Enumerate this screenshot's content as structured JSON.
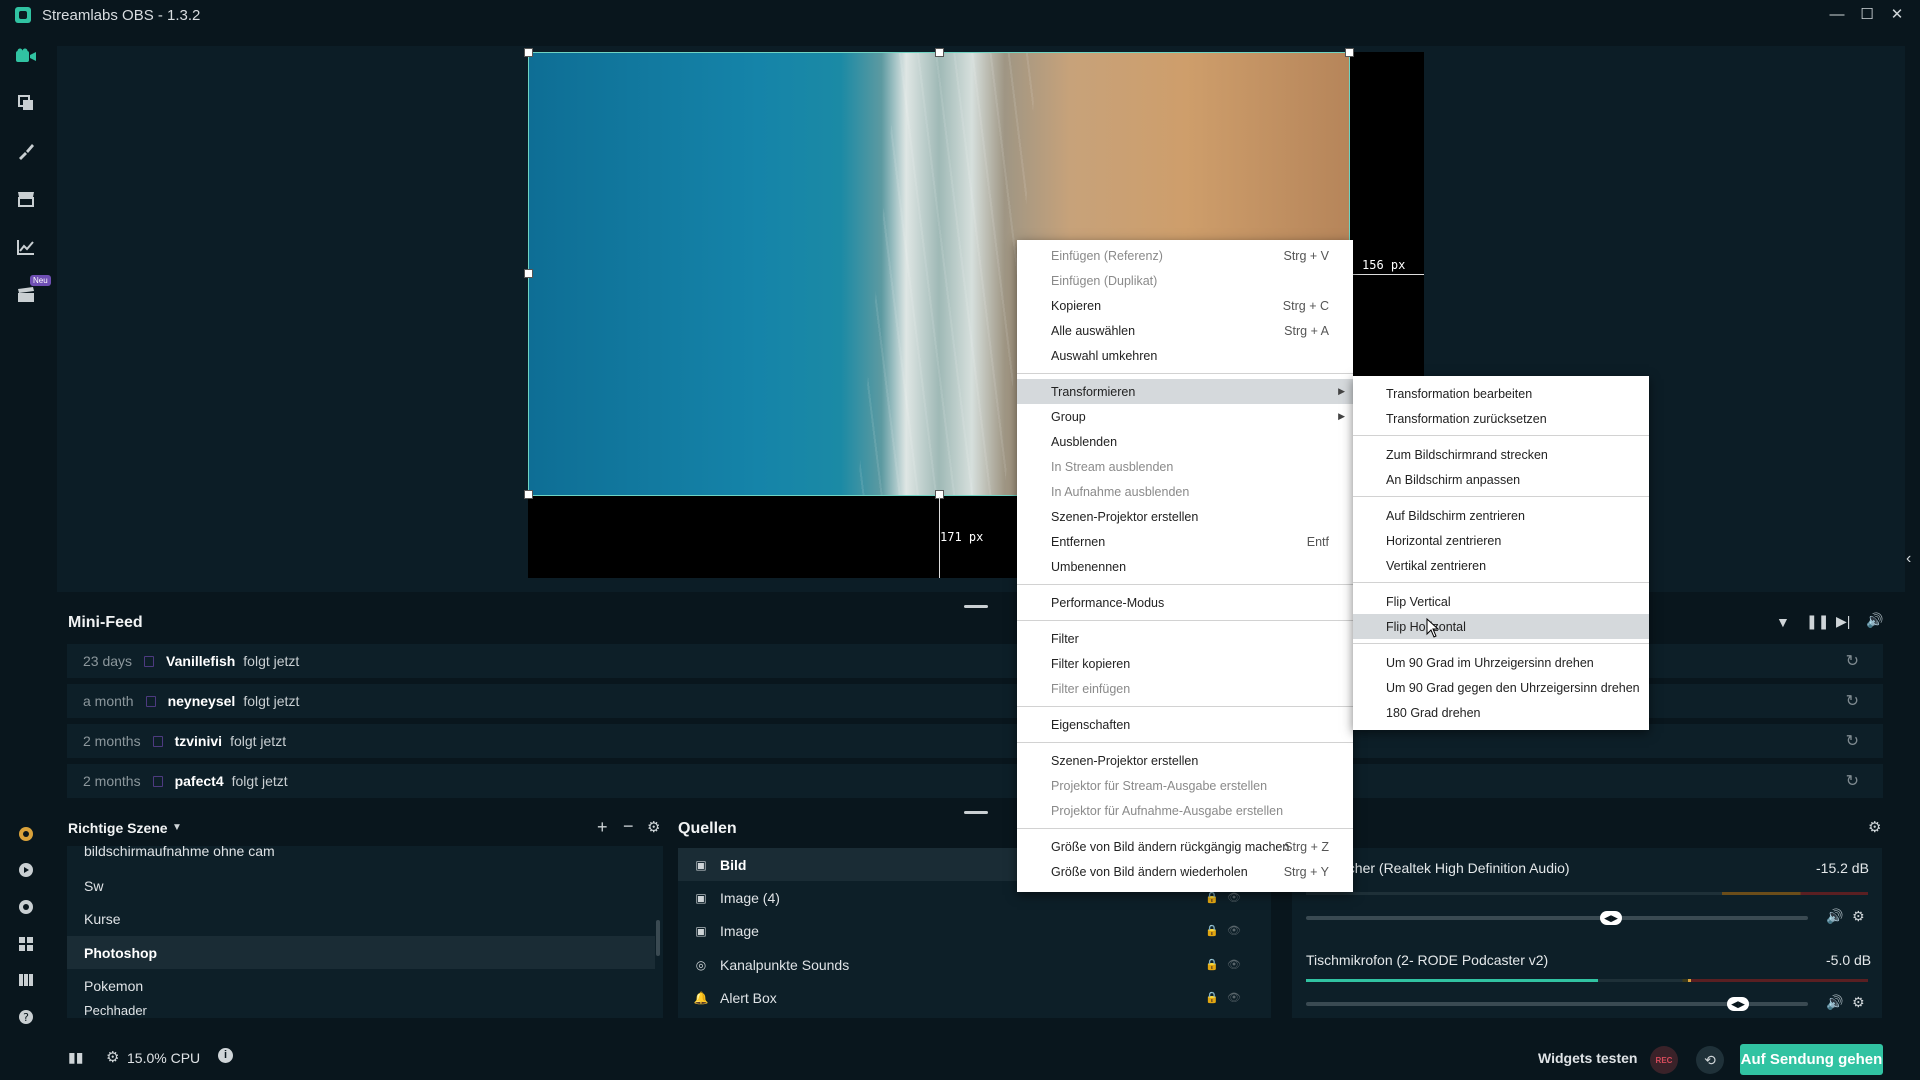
{
  "window": {
    "title": "Streamlabs OBS - 1.3.2",
    "min": "—",
    "max": "☐",
    "close": "✕"
  },
  "sidebar": {
    "neu_badge": "Neu"
  },
  "preview": {
    "px_right": "156 px",
    "px_bottom": "171 px"
  },
  "minifeed": {
    "title": "Mini-Feed",
    "rows": [
      {
        "time": "23 days",
        "user": "Vanillefish",
        "action": "folgt jetzt"
      },
      {
        "time": "a month",
        "user": "neyneysel",
        "action": "folgt jetzt"
      },
      {
        "time": "2 months",
        "user": "tzvinivi",
        "action": "folgt jetzt"
      },
      {
        "time": "2 months",
        "user": "pafect4",
        "action": "folgt jetzt"
      }
    ]
  },
  "scenes": {
    "title": "Richtige Szene",
    "items": [
      "bildschirmaufnahme ohne cam",
      "Sw",
      "Kurse",
      "Photoshop",
      "Pokemon",
      "Pechhader"
    ]
  },
  "sources": {
    "title": "Quellen",
    "items": [
      {
        "label": "Bild",
        "icon": "image-icon"
      },
      {
        "label": "Image (4)",
        "icon": "image-icon"
      },
      {
        "label": "Image",
        "icon": "image-icon"
      },
      {
        "label": "Kanalpunkte Sounds",
        "icon": "globe-icon"
      },
      {
        "label": "Alert Box",
        "icon": "bell-icon"
      }
    ]
  },
  "mixer": {
    "items": [
      {
        "name": "echer (Realtek High Definition Audio)",
        "db": "-15.2 dB",
        "level": 0.6
      },
      {
        "name": "Tischmikrofon (2- RODE Podcaster v2)",
        "db": "-5.0 dB",
        "level": 0.87
      }
    ]
  },
  "status": {
    "cpu": "15.0% CPU",
    "widgets": "Widgets testen",
    "rec": "REC",
    "go_live": "Auf Sendung gehen"
  },
  "context_menu": {
    "items": [
      {
        "label": "Einfügen (Referenz)",
        "shortcut": "Strg + V",
        "disabled": true
      },
      {
        "label": "Einfügen (Duplikat)",
        "shortcut": "",
        "disabled": true
      },
      {
        "label": "Kopieren",
        "shortcut": "Strg + C"
      },
      {
        "label": "Alle auswählen",
        "shortcut": "Strg + A"
      },
      {
        "label": "Auswahl umkehren",
        "shortcut": ""
      },
      {
        "label": "Transformieren",
        "shortcut": "",
        "submenu": true
      },
      {
        "label": "Group",
        "shortcut": "",
        "submenu": true
      },
      {
        "label": "Ausblenden",
        "shortcut": ""
      },
      {
        "label": "In Stream ausblenden",
        "shortcut": "",
        "disabled": true
      },
      {
        "label": "In Aufnahme ausblenden",
        "shortcut": "",
        "disabled": true
      },
      {
        "label": "Szenen-Projektor erstellen",
        "shortcut": ""
      },
      {
        "label": "Entfernen",
        "shortcut": "Entf"
      },
      {
        "label": "Umbenennen",
        "shortcut": ""
      },
      {
        "label": "Performance-Modus",
        "shortcut": ""
      },
      {
        "label": "Filter",
        "shortcut": ""
      },
      {
        "label": "Filter kopieren",
        "shortcut": ""
      },
      {
        "label": "Filter einfügen",
        "shortcut": "",
        "disabled": true
      },
      {
        "label": "Eigenschaften",
        "shortcut": ""
      },
      {
        "label": "Szenen-Projektor erstellen",
        "shortcut": ""
      },
      {
        "label": "Projektor für Stream-Ausgabe erstellen",
        "shortcut": "",
        "disabled": true
      },
      {
        "label": "Projektor für Aufnahme-Ausgabe erstellen",
        "shortcut": "",
        "disabled": true
      },
      {
        "label": "Größe von Bild ändern rückgängig machen",
        "shortcut": "Strg + Z"
      },
      {
        "label": "Größe von Bild ändern wiederholen",
        "shortcut": "Strg + Y"
      }
    ]
  },
  "transform_submenu": {
    "items": [
      "Transformation bearbeiten",
      "Transformation zurücksetzen",
      "Zum Bildschirmrand strecken",
      "An Bildschirm anpassen",
      "Auf Bildschirm zentrieren",
      "Horizontal zentrieren",
      "Vertikal zentrieren",
      "Flip Vertical",
      "Flip Horizontal",
      "Um 90 Grad im Uhrzeigersinn drehen",
      "Um 90 Grad gegen den Uhrzeigersinn drehen",
      "180 Grad drehen"
    ]
  }
}
